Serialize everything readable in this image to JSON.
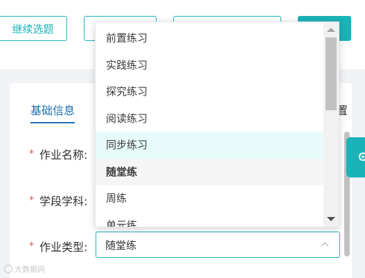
{
  "toolbar": {
    "continue_label": "继续选题",
    "button2_label": "",
    "button3_label": "",
    "primary_label": ""
  },
  "form": {
    "tab_label": "基础信息",
    "tab_right_clip": "置",
    "fields": {
      "name_label": "作业名称:",
      "subject_label": "学段学科:",
      "type_label": "作业类型:"
    },
    "type_value": "随堂练"
  },
  "dropdown": {
    "options": [
      "前置练习",
      "实践练习",
      "探究练习",
      "阅读练习",
      "同步练习",
      "随堂练",
      "周练",
      "单元练"
    ],
    "hovered_index": 4,
    "selected_index": 5
  },
  "watermark": "大数据网",
  "colors": {
    "accent": "#1bb3b8",
    "tab_blue": "#1b6ea8",
    "required": "#e05353",
    "hover_bg": "#e8fbfb"
  }
}
